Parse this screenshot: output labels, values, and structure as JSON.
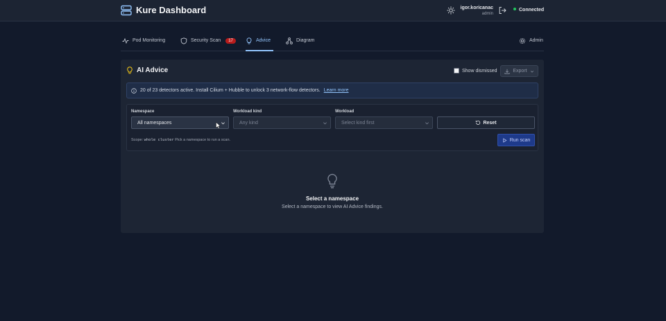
{
  "header": {
    "app_title": "Kure Dashboard",
    "user_name": "igor.koricanac",
    "user_role": "admin",
    "connection_status": "Connected",
    "status_color": "#22c55e"
  },
  "tabs": [
    {
      "label": "Pod Monitoring",
      "icon": "activity-icon",
      "active": false
    },
    {
      "label": "Security Scan",
      "icon": "shield-icon",
      "badge": "17",
      "active": false
    },
    {
      "label": "Advice",
      "icon": "lightbulb-icon",
      "active": true
    },
    {
      "label": "Diagram",
      "icon": "diagram-icon",
      "active": false
    }
  ],
  "admin_tab": {
    "label": "Admin",
    "icon": "gear-icon"
  },
  "panel": {
    "title": "AI Advice",
    "show_dismissed_label": "Show dismissed",
    "show_dismissed_checked": false,
    "export_label": "Export"
  },
  "info_banner": {
    "text": "20 of 23 detectors active. Install Cilium + Hubble to unlock 3 network-flow detectors.",
    "link": "Learn more"
  },
  "filters": {
    "namespace": {
      "label": "Namespace",
      "value": "All namespaces"
    },
    "workload_kind": {
      "label": "Workload kind",
      "value": "Any kind"
    },
    "workload": {
      "label": "Workload",
      "value": "Select kind first"
    },
    "reset_label": "Reset",
    "run_label": "Run scan",
    "scope_prefix": "Scope:",
    "scope_value": "whole cluster",
    "scope_hint": "Pick a namespace to run a scan."
  },
  "empty_state": {
    "title": "Select a namespace",
    "subtitle": "Select a namespace to view AI Advice findings."
  },
  "colors": {
    "accent": "#93c5fd",
    "badge": "#b91c1c",
    "run_button": "#1e3a8a"
  }
}
